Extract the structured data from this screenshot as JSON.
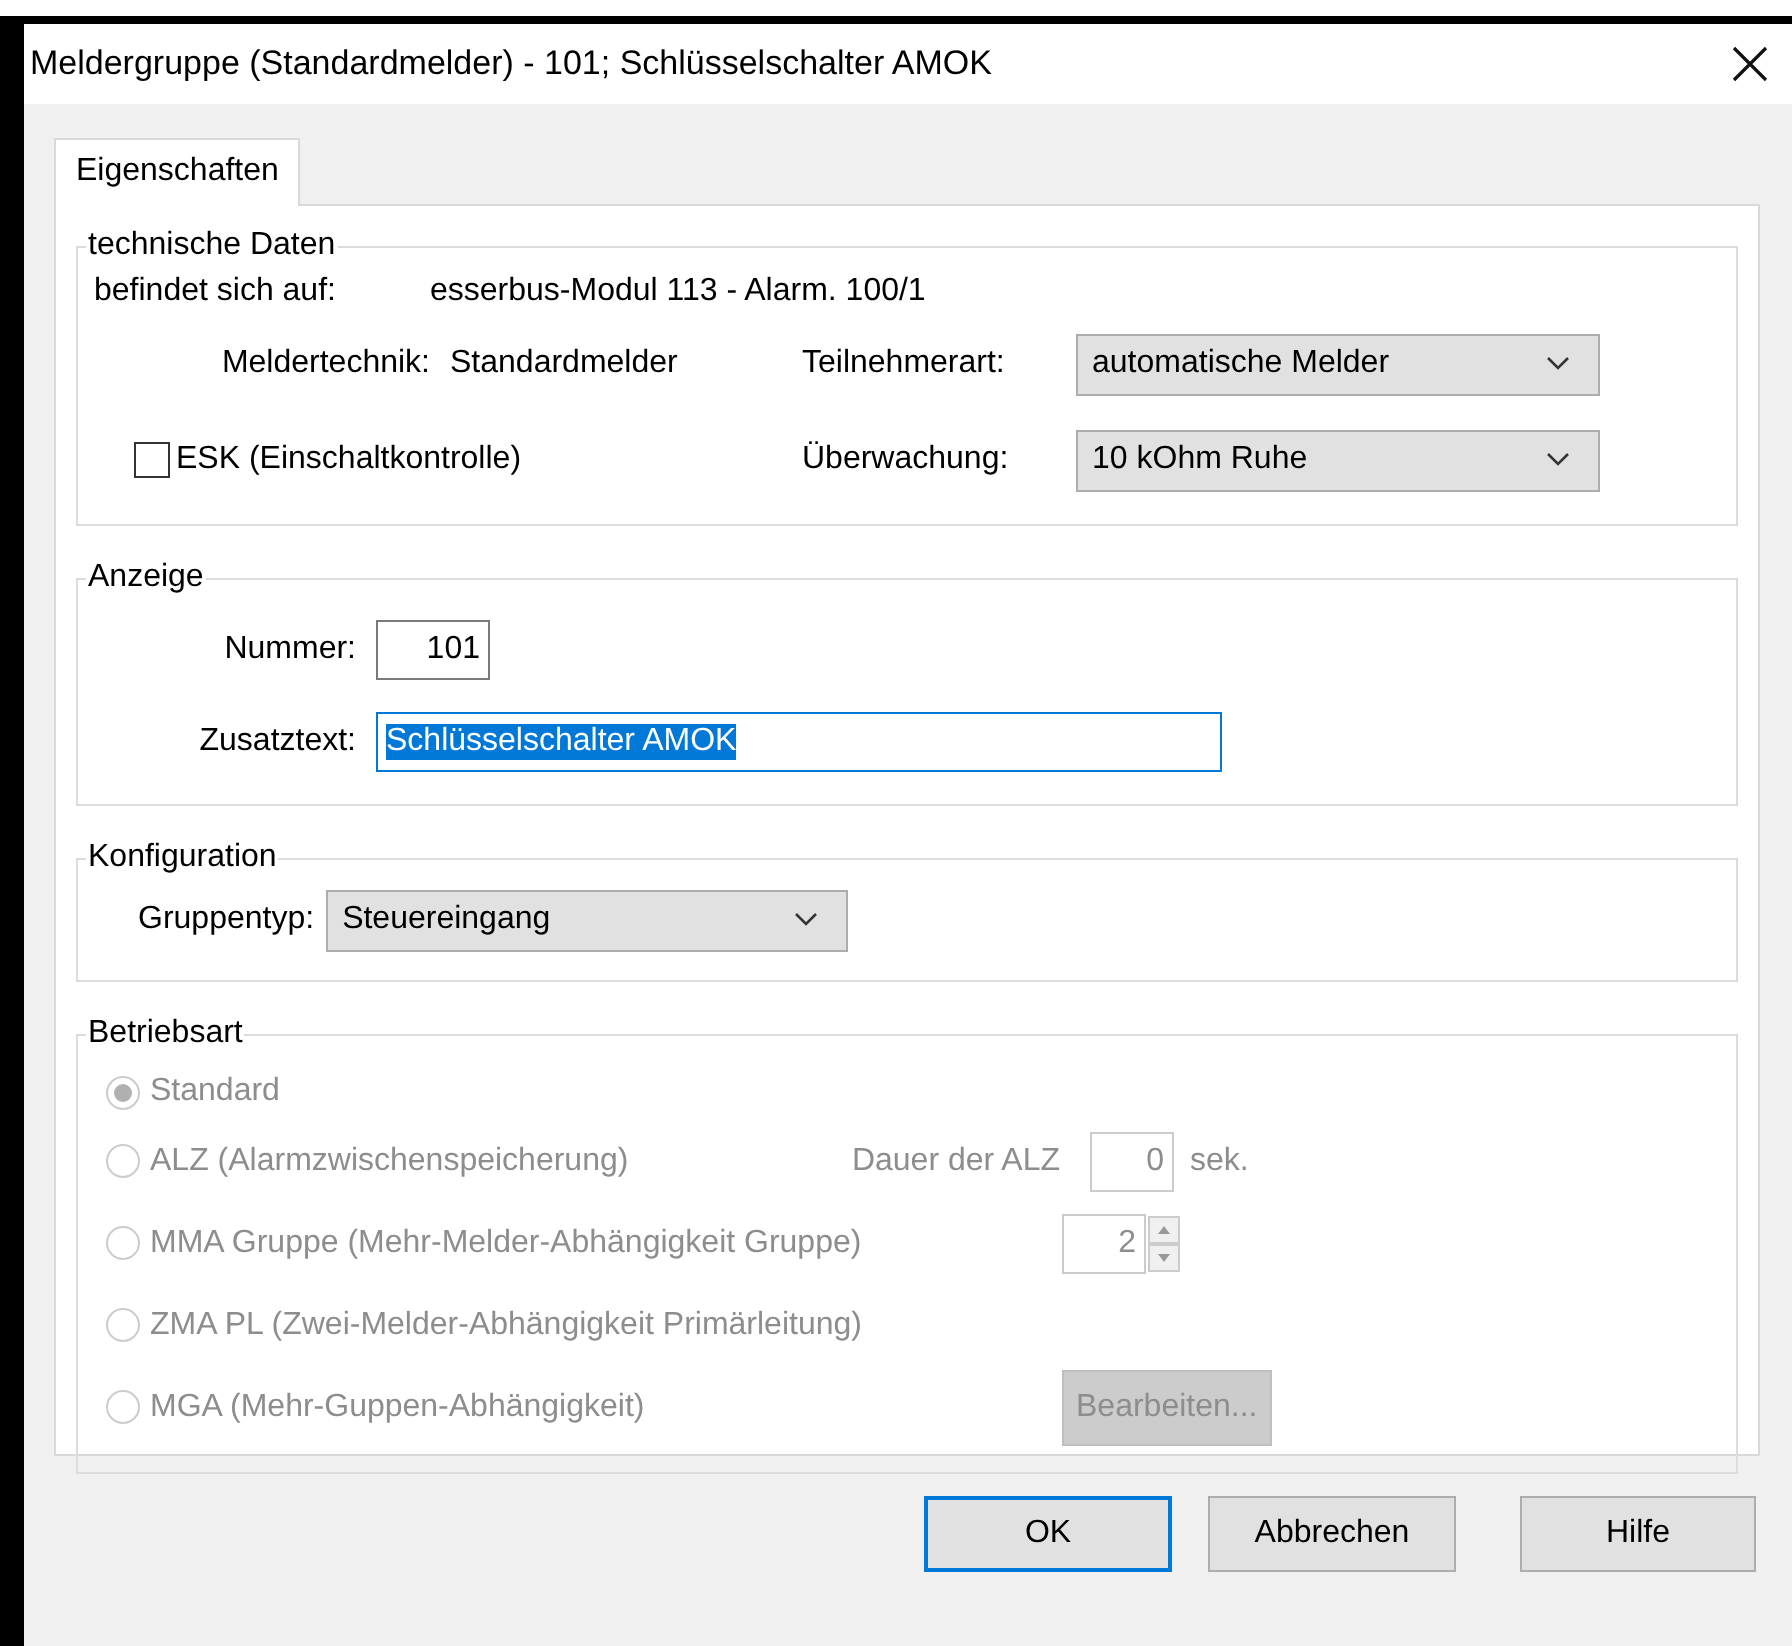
{
  "window": {
    "title": "Meldergruppe (Standardmelder) - 101; Schlüsselschalter AMOK"
  },
  "tabs": [
    {
      "label": "Eigenschaften",
      "selected": true
    }
  ],
  "technische_daten": {
    "title": "technische Daten",
    "location_label": "befindet sich auf:",
    "location_value": "esserbus-Modul 113 - Alarm. 100/1",
    "technik_label": "Meldertechnik:",
    "technik_value": "Standardmelder",
    "teilnehmerart": {
      "label": "Teilnehmerart:",
      "value": "automatische Melder"
    },
    "ueberwachung": {
      "label": "Überwachung:",
      "value": "10 kOhm Ruhe"
    },
    "esk": {
      "label": "ESK (Einschaltkontrolle)",
      "checked": false
    }
  },
  "anzeige": {
    "title": "Anzeige",
    "nummer": {
      "label": "Nummer:",
      "value": "101"
    },
    "zusatztext": {
      "label": "Zusatztext:",
      "value": "Schlüsselschalter AMOK",
      "text_selected": true,
      "focused": true
    }
  },
  "konfiguration": {
    "title": "Konfiguration",
    "gruppentyp": {
      "label": "Gruppentyp:",
      "value": "Steuereingang"
    }
  },
  "betriebsart": {
    "title": "Betriebsart",
    "disabled": true,
    "options": [
      {
        "kind": "plain",
        "label": "Standard",
        "selected": true
      },
      {
        "kind": "duration",
        "label": "ALZ (Alarmzwischenspeicherung)",
        "selected": false,
        "extra_label": "Dauer der ALZ",
        "value": "0",
        "unit": "sek."
      },
      {
        "kind": "spinner",
        "label": "MMA Gruppe (Mehr-Melder-Abhängigkeit Gruppe)",
        "selected": false,
        "value": "2"
      },
      {
        "kind": "plain",
        "label": "ZMA PL (Zwei-Melder-Abhängigkeit Primärleitung)",
        "selected": false
      },
      {
        "kind": "button",
        "label": "MGA (Mehr-Guppen-Abhängigkeit)",
        "selected": false,
        "button": "Bearbeiten..."
      }
    ]
  },
  "buttons": [
    {
      "label": "OK",
      "default": true
    },
    {
      "label": "Abbrechen",
      "default": false
    },
    {
      "label": "Hilfe",
      "default": false
    }
  ]
}
